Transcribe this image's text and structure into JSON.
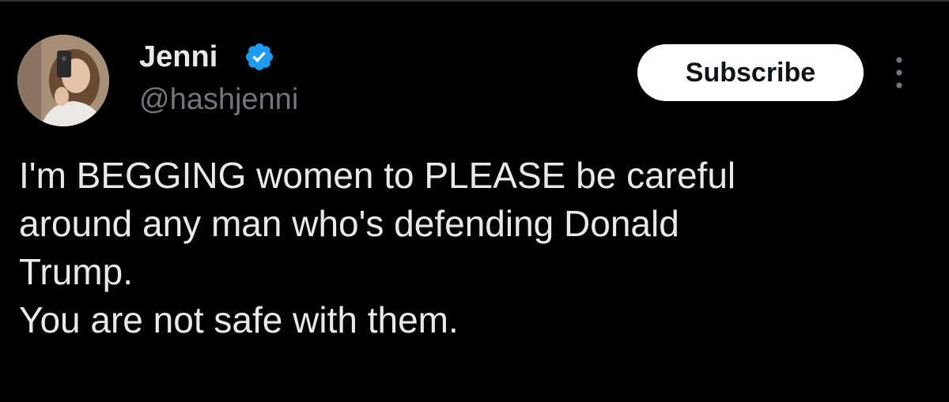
{
  "author": {
    "name": "Jenni",
    "handle": "@hashjenni",
    "verified": true,
    "verified_icon": "verified-badge-icon",
    "avatar": "avatar-photo"
  },
  "actions": {
    "subscribe_label": "Subscribe",
    "more_icon": "more-options-icon"
  },
  "tweet": {
    "lines": [
      "I'm BEGGING women to PLEASE be careful",
      "around any man who's defending Donald",
      "Trump.",
      "You are not safe with them."
    ]
  },
  "colors": {
    "background": "#000000",
    "text": "#e7e9ea",
    "handle": "#71767b",
    "verified": "#1d9bf0",
    "subscribe_bg": "#ffffff",
    "subscribe_text": "#0f1419"
  }
}
